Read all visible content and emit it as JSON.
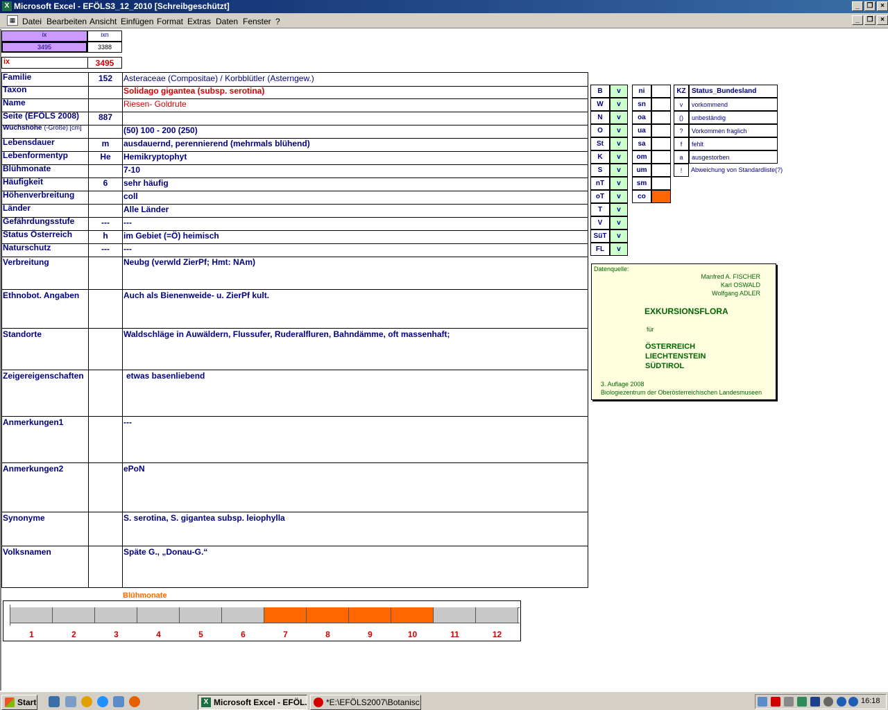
{
  "window": {
    "title": "Microsoft Excel - EFÖLS3_12_2010  [Schreibgeschützt]"
  },
  "menu": [
    "Datei",
    "Bearbeiten",
    "Ansicht",
    "Einfügen",
    "Format",
    "Extras",
    "Daten",
    "Fenster",
    "?"
  ],
  "index": {
    "ix_label": "ix",
    "ixn_label": "ixn",
    "ix_value": "3495",
    "ixn_value": "3388",
    "ix2_label": "ix",
    "ix2_value": "3495"
  },
  "rows": [
    {
      "label": "Familie",
      "code": "152",
      "value": "Asteraceae (Compositae)  /  Korbblütler (Asterngew.)"
    },
    {
      "label": "Taxon",
      "code": "",
      "value": "Solidago gigantea (subsp. serotina)"
    },
    {
      "label": "Name",
      "code": "",
      "value": "Riesen- Goldrute"
    },
    {
      "label": "Seite (EFÖLS 2008)",
      "code": "887",
      "value": ""
    },
    {
      "label": "Wuchshöhe",
      "label_extra": "(-Größe) [cm]",
      "code": "",
      "value": "(50) 100 - 200 (250)"
    },
    {
      "label": "Lebensdauer",
      "code": "m",
      "value": "ausdauernd, perennierend (mehrmals blühend)"
    },
    {
      "label": "Lebenformentyp",
      "code": "He",
      "value": "Hemikryptophyt"
    },
    {
      "label": "Blühmonate",
      "code": "",
      "value": "7-10"
    },
    {
      "label": "Häufigkeit",
      "code": "6",
      "value": "sehr häufig"
    },
    {
      "label": "Höhenverbreitung",
      "code": "",
      "value": "coll"
    },
    {
      "label": "Länder",
      "code": "",
      "value": "Alle Länder"
    },
    {
      "label": "Gefährdungsstufe",
      "code": "---",
      "value": "---"
    },
    {
      "label": "Status Österreich",
      "code": "h",
      "value": "im Gebiet (=Ö) heimisch"
    },
    {
      "label": "Naturschutz",
      "code": "---",
      "value": "---"
    }
  ],
  "big_rows": [
    {
      "label": "Verbreitung",
      "value": "Neubg (verwld ZierPf; Hmt: NAm)"
    },
    {
      "label": "Ethnobot. Angaben",
      "value": "Auch als Bienenweide- u. ZierPf kult."
    },
    {
      "label": "Standorte",
      "value": "Waldschläge in Auwäldern, Flussufer, Ruderalfluren, Bahndämme, oft massenhaft;"
    },
    {
      "label": "Zeigereigenschaften",
      "value": "etwas basenliebend"
    },
    {
      "label": "Anmerkungen1",
      "value": "---"
    },
    {
      "label": "Anmerkungen2",
      "value": "ePoN"
    },
    {
      "label": "Synonyme",
      "value": "S. serotina, S. gigantea subsp. leiophylla"
    },
    {
      "label": "Volksnamen",
      "value": "Späte G., „Donau-G.“"
    }
  ],
  "states": [
    {
      "code": "B",
      "value": "v"
    },
    {
      "code": "W",
      "value": "v"
    },
    {
      "code": "N",
      "value": "v"
    },
    {
      "code": "O",
      "value": "v"
    },
    {
      "code": "St",
      "value": "v"
    },
    {
      "code": "K",
      "value": "v"
    },
    {
      "code": "S",
      "value": "v"
    },
    {
      "code": "nT",
      "value": "v"
    },
    {
      "code": "oT",
      "value": "v"
    },
    {
      "code": "T",
      "value": "v"
    },
    {
      "code": "V",
      "value": "v"
    },
    {
      "code": "SüT",
      "value": "v"
    },
    {
      "code": "FL",
      "value": "v"
    }
  ],
  "altitude": [
    "ni",
    "sn",
    "oa",
    "ua",
    "sa",
    "om",
    "um",
    "sm",
    "co"
  ],
  "legend": {
    "header_kz": "KZ",
    "header_label": "Status_Bundesland",
    "items": [
      {
        "kz": "v",
        "text": "vorkommend"
      },
      {
        "kz": "()",
        "text": "unbeständig"
      },
      {
        "kz": "?",
        "text": "Vorkommen fraglich"
      },
      {
        "kz": "f",
        "text": "fehlt"
      },
      {
        "kz": "a",
        "text": "ausgestorben"
      },
      {
        "kz": "!",
        "text": "Abweichung von Standardliste(?)"
      }
    ]
  },
  "source": {
    "label": "Datenquelle:",
    "authors": [
      "Manfred A. FISCHER",
      "Karl OSWALD",
      "Wolfgang ADLER"
    ],
    "title": "EXKURSIONSFLORA",
    "fuer": "für",
    "regions": [
      "ÖSTERREICH",
      "LIECHTENSTEIN",
      "SÜDTIROL"
    ],
    "edition": "3. Auflage 2008",
    "publisher": "Biologiezentrum der Oberösterreichischen Landesmuseen"
  },
  "bluehmonate_chart": {
    "title": "Blühmonate",
    "months": [
      "1",
      "2",
      "3",
      "4",
      "5",
      "6",
      "7",
      "8",
      "9",
      "10",
      "11",
      "12"
    ],
    "active": [
      7,
      8,
      9,
      10
    ],
    "colors": {
      "active": "#ff6600",
      "inactive": "#c8c8c8"
    }
  },
  "taskbar": {
    "start": "Start",
    "tasks": [
      "Microsoft Excel - EFÖL...",
      "*E:\\EFÖLS2007\\Botanisc..."
    ],
    "clock": "16:18"
  },
  "colors": {
    "accent": "#ff6600",
    "navy": "#000080",
    "red": "#d40000",
    "ix_bg": "#cc99ff",
    "valid_bg": "#ccffcc",
    "source_bg": "#ffffe0"
  }
}
